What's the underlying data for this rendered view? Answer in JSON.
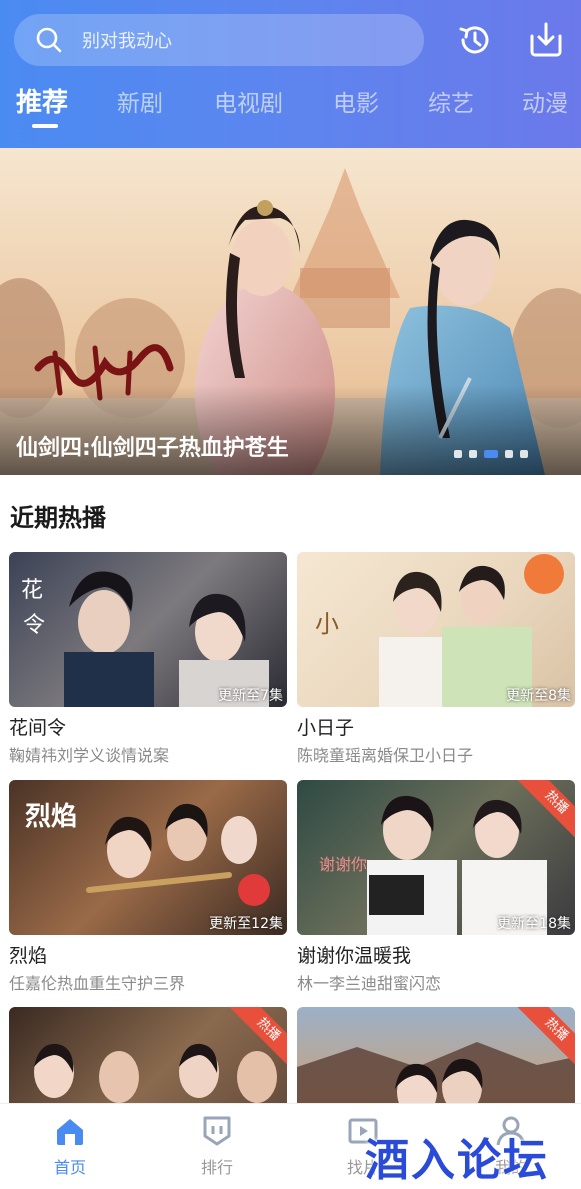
{
  "search": {
    "placeholder": "别对我动心"
  },
  "header": {
    "history_icon": "history-icon",
    "download_icon": "download-icon"
  },
  "tabs": [
    {
      "label": "推荐",
      "active": true
    },
    {
      "label": "新剧"
    },
    {
      "label": "电视剧"
    },
    {
      "label": "电影"
    },
    {
      "label": "综艺"
    },
    {
      "label": "动漫"
    }
  ],
  "banner": {
    "title": "仙剑四:仙剑四子热血护苍生",
    "slide_count": 5,
    "active_slide": 3
  },
  "section": {
    "title": "近期热播"
  },
  "cards": [
    {
      "title": "花间令",
      "desc": "鞠婧祎刘学义谈情说案",
      "update": "更新至7集",
      "badge": ""
    },
    {
      "title": "小日子",
      "desc": "陈晓童瑶离婚保卫小日子",
      "update": "更新至8集",
      "badge": ""
    },
    {
      "title": "烈焰",
      "desc": "任嘉伦热血重生守护三界",
      "update": "更新至12集",
      "badge": ""
    },
    {
      "title": "谢谢你温暖我",
      "desc": "林一李兰迪甜蜜闪恋",
      "update": "更新至18集",
      "badge": "热播"
    },
    {
      "title": "",
      "desc": "",
      "update": "",
      "badge": "热播"
    },
    {
      "title": "",
      "desc": "",
      "update": "",
      "badge": "热播"
    }
  ],
  "nav": [
    {
      "label": "首页",
      "icon": "home-icon",
      "active": true
    },
    {
      "label": "排行",
      "icon": "ranking-icon"
    },
    {
      "label": "找片",
      "icon": "find-icon"
    },
    {
      "label": "我的",
      "icon": "profile-icon"
    }
  ],
  "watermark": "酒入论坛",
  "colors": {
    "accent": "#4a8bf2",
    "hot_badge": "#e8503c"
  }
}
